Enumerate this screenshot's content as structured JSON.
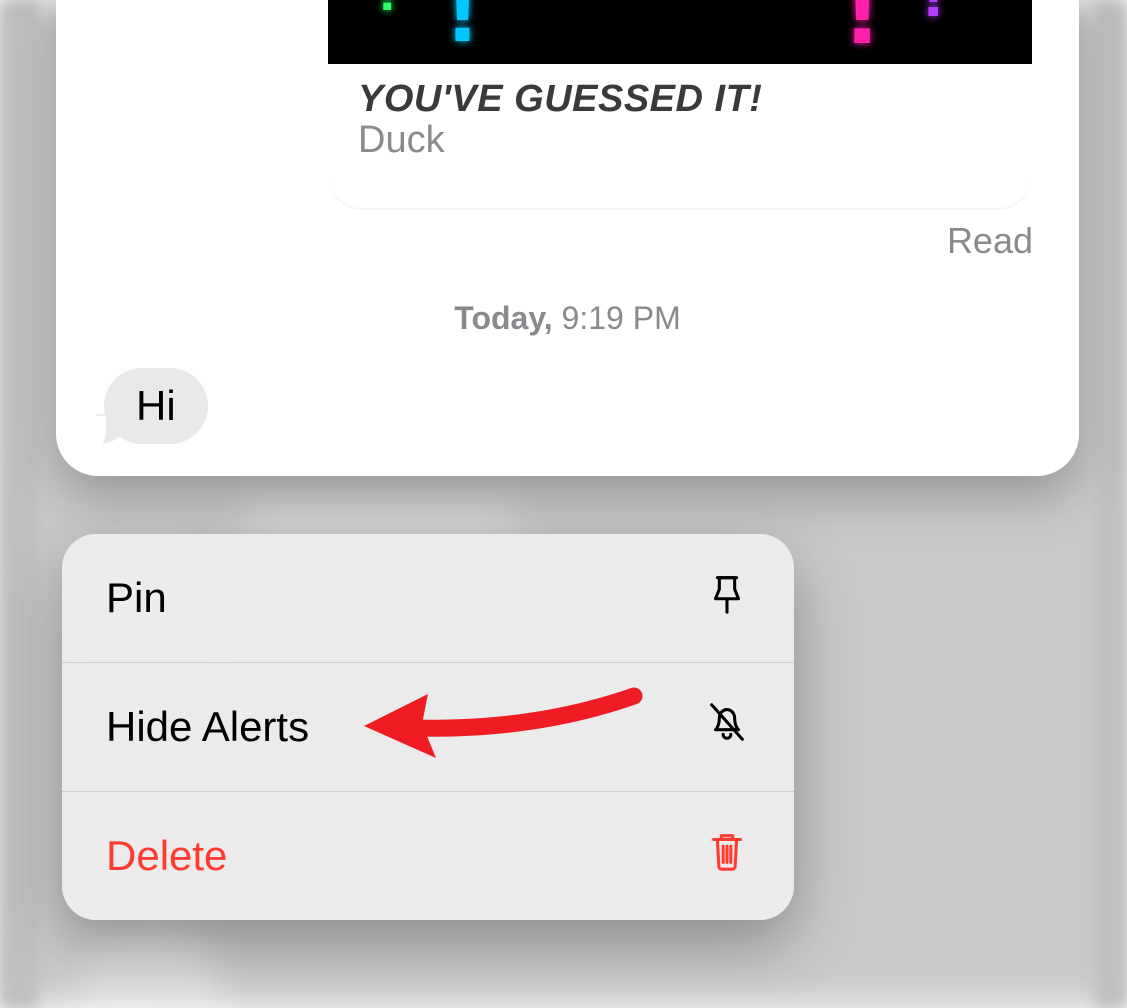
{
  "chat": {
    "game_card": {
      "title": "YOU'VE GUESSED IT!",
      "subtitle": "Duck"
    },
    "read_receipt": "Read",
    "timestamp_day": "Today,",
    "timestamp_time": "9:19 PM",
    "incoming_message": "Hi"
  },
  "menu": {
    "items": [
      {
        "label": "Pin",
        "icon": "pin-icon",
        "destructive": false
      },
      {
        "label": "Hide Alerts",
        "icon": "bell-off-icon",
        "destructive": false
      },
      {
        "label": "Delete",
        "icon": "trash-icon",
        "destructive": true
      }
    ]
  },
  "annotation": {
    "target_label": "Hide Alerts"
  }
}
